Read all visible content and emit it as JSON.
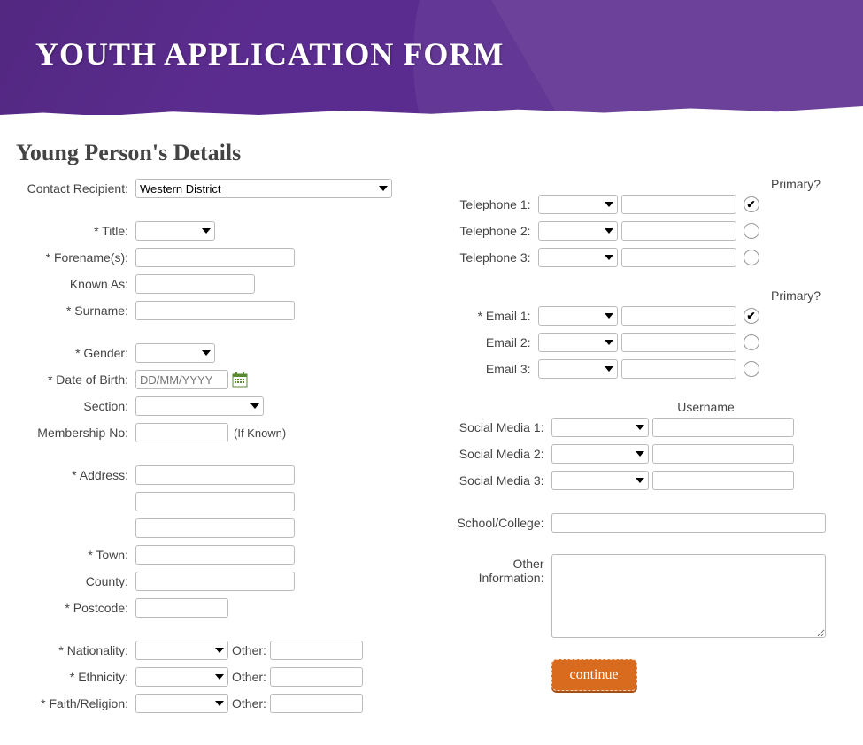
{
  "header": {
    "title": "YOUTH APPLICATION FORM"
  },
  "section_title": "Young Person's Details",
  "left": {
    "contact_recipient_label": "Contact Recipient:",
    "contact_recipient_value": "Western District",
    "title_label": "* Title:",
    "forenames_label": "* Forename(s):",
    "known_as_label": "Known As:",
    "surname_label": "* Surname:",
    "gender_label": "* Gender:",
    "dob_label": "* Date of Birth:",
    "dob_placeholder": "DD/MM/YYYY",
    "section_label": "Section:",
    "membership_label": "Membership No:",
    "membership_hint": "(If Known)",
    "address_label": "* Address:",
    "town_label": "* Town:",
    "county_label": "County:",
    "postcode_label": "* Postcode:",
    "nationality_label": "* Nationality:",
    "ethnicity_label": "* Ethnicity:",
    "faith_label": "* Faith/Religion:",
    "other_label": "Other:"
  },
  "right": {
    "primary_header": "Primary?",
    "tel1_label": "Telephone 1:",
    "tel2_label": "Telephone 2:",
    "tel3_label": "Telephone 3:",
    "email1_label": "* Email 1:",
    "email2_label": "Email 2:",
    "email3_label": "Email 3:",
    "username_header": "Username",
    "sm1_label": "Social Media 1:",
    "sm2_label": "Social Media 2:",
    "sm3_label": "Social Media 3:",
    "school_label": "School/College:",
    "other_info_label": "Other Information:",
    "continue_btn": "continue"
  }
}
